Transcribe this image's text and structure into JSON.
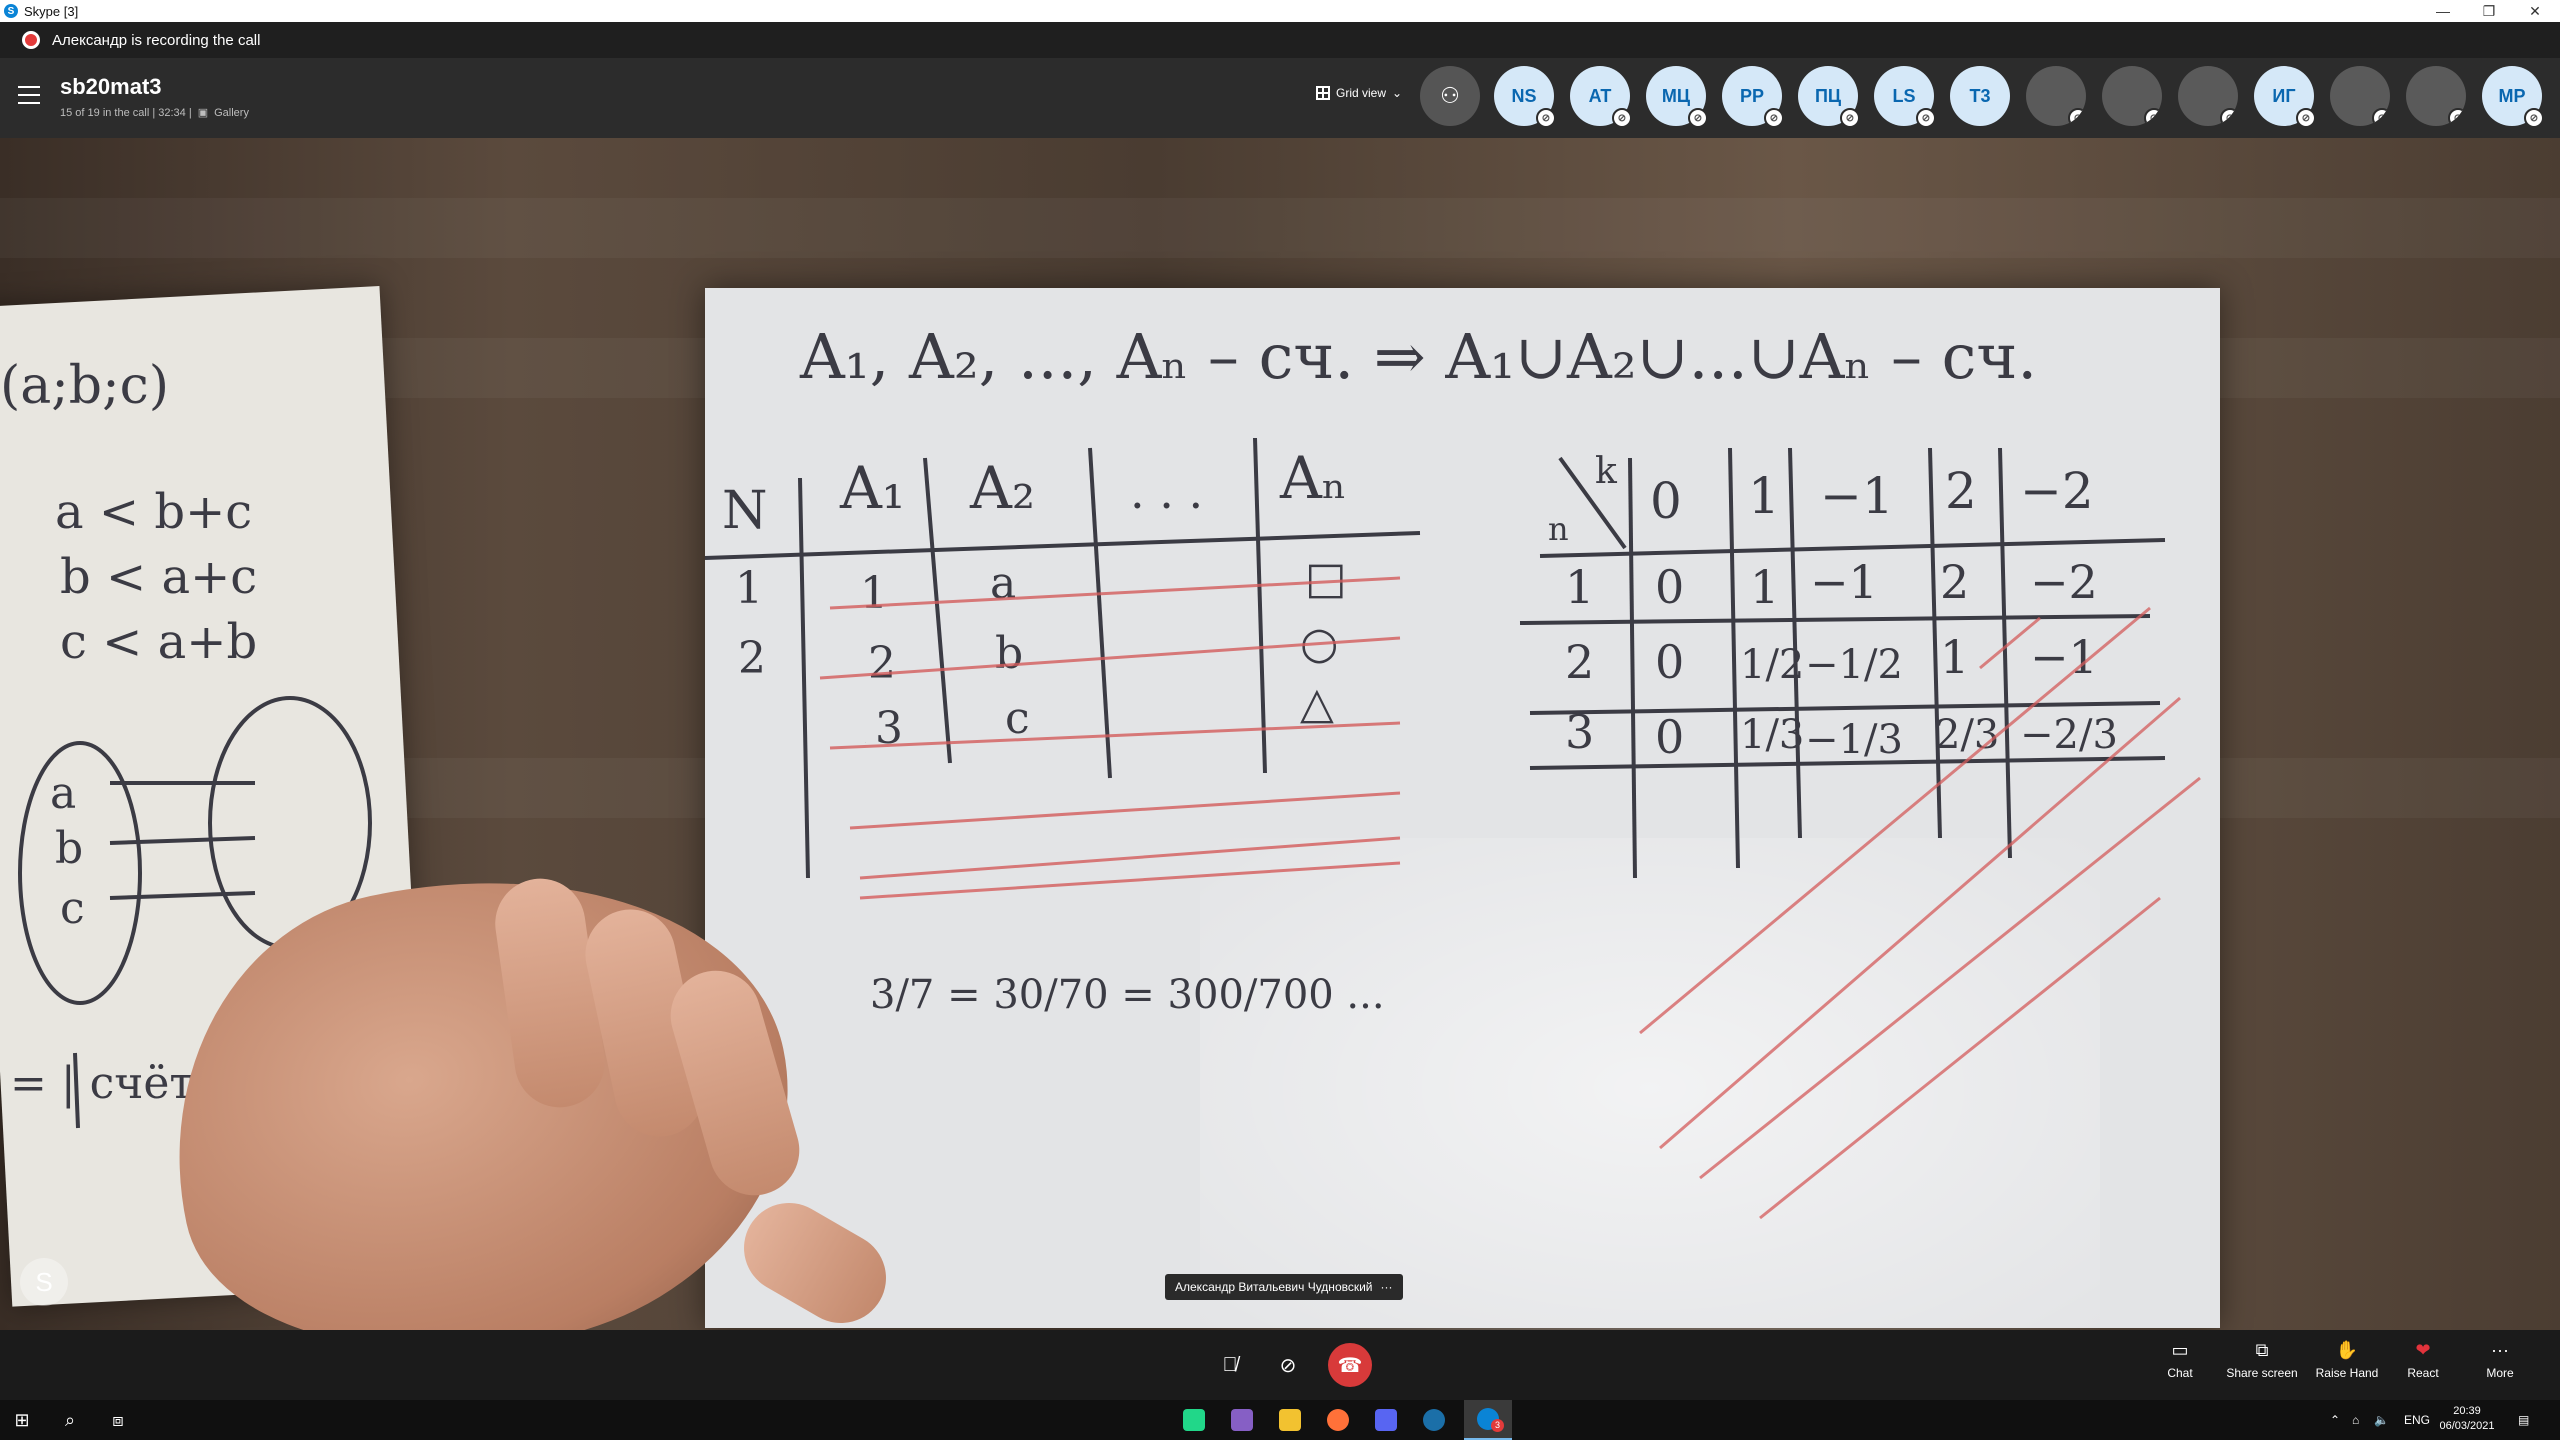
{
  "window": {
    "app_icon": "skype-icon",
    "title": "Skype [3]",
    "controls": [
      "minimize-icon",
      "restore-icon",
      "close-icon"
    ]
  },
  "recording": {
    "text": "Александр is recording the call",
    "color": "#e23b3b"
  },
  "call": {
    "title": "sb20mat3",
    "meta": "15 of 19 in the call | 32:34 |",
    "gallery_label": "Gallery",
    "view_label": "Grid view",
    "add_people_icon": "add-person-icon"
  },
  "participants": [
    {
      "initials": "NS",
      "muted": true
    },
    {
      "initials": "AT",
      "muted": true
    },
    {
      "initials": "МЦ",
      "muted": true
    },
    {
      "initials": "PP",
      "muted": true
    },
    {
      "initials": "ПЦ",
      "muted": true
    },
    {
      "initials": "LS",
      "muted": true
    },
    {
      "initials": "T3",
      "muted": false
    },
    {
      "initials": "",
      "muted": true,
      "photo": true
    },
    {
      "initials": "",
      "muted": true,
      "photo": true
    },
    {
      "initials": "",
      "muted": true,
      "photo": true
    },
    {
      "initials": "ИГ",
      "muted": true
    },
    {
      "initials": "",
      "muted": true,
      "photo": true
    },
    {
      "initials": "",
      "muted": true,
      "photo": true
    },
    {
      "initials": "MP",
      "muted": true
    }
  ],
  "video": {
    "speaker_name": "Александр Витальевич Чудновский",
    "speaker_more": "···",
    "watermark": "S",
    "board": {
      "header": "A₁, A₂, ..., Aₙ – сч. ⇒ A₁∪A₂∪...∪Aₙ – сч.",
      "left_table_cols": [
        "N",
        "A₁",
        "A₂",
        ". . .",
        "Aₙ"
      ],
      "left_table_rows": [
        [
          "1",
          "1",
          "a",
          "□"
        ],
        [
          "2",
          "2",
          "b",
          "○"
        ],
        [
          "3",
          "3",
          "c",
          "△"
        ]
      ],
      "fraction_text": "3/7 = 30/70 = 300/700 ...",
      "right_table_cols": [
        "k",
        "0",
        "1",
        "−1",
        "2",
        "−2"
      ],
      "right_table_rowlabel": "n",
      "right_table_rows": [
        [
          "1",
          "0",
          "1",
          "−1",
          "2",
          "−2"
        ],
        [
          "2",
          "0",
          "1/2",
          "−1/2",
          "1",
          "−1"
        ],
        [
          "3",
          "0",
          "1/3",
          "−1/3",
          "2/3",
          "−2/3"
        ]
      ],
      "left_sheet": [
        "(a;b;c)",
        "a < b+c",
        "b < a+c",
        "c < a+b",
        "a",
        "b",
        "c",
        "= | счёт N |"
      ]
    }
  },
  "controls": {
    "mic_icon": "mic-muted-icon",
    "video_icon": "video-off-icon",
    "end_icon": "end-call-icon",
    "end_color": "#d83a3a",
    "right": [
      {
        "label": "Chat",
        "icon": "chat-icon"
      },
      {
        "label": "Share screen",
        "icon": "share-screen-icon"
      },
      {
        "label": "Raise Hand",
        "icon": "raise-hand-icon"
      },
      {
        "label": "React",
        "icon": "heart-icon"
      },
      {
        "label": "More",
        "icon": "more-icon"
      }
    ]
  },
  "taskbar": {
    "language": "ENG",
    "time": "20:39",
    "date": "06/03/2021",
    "skype_badge": "3"
  }
}
